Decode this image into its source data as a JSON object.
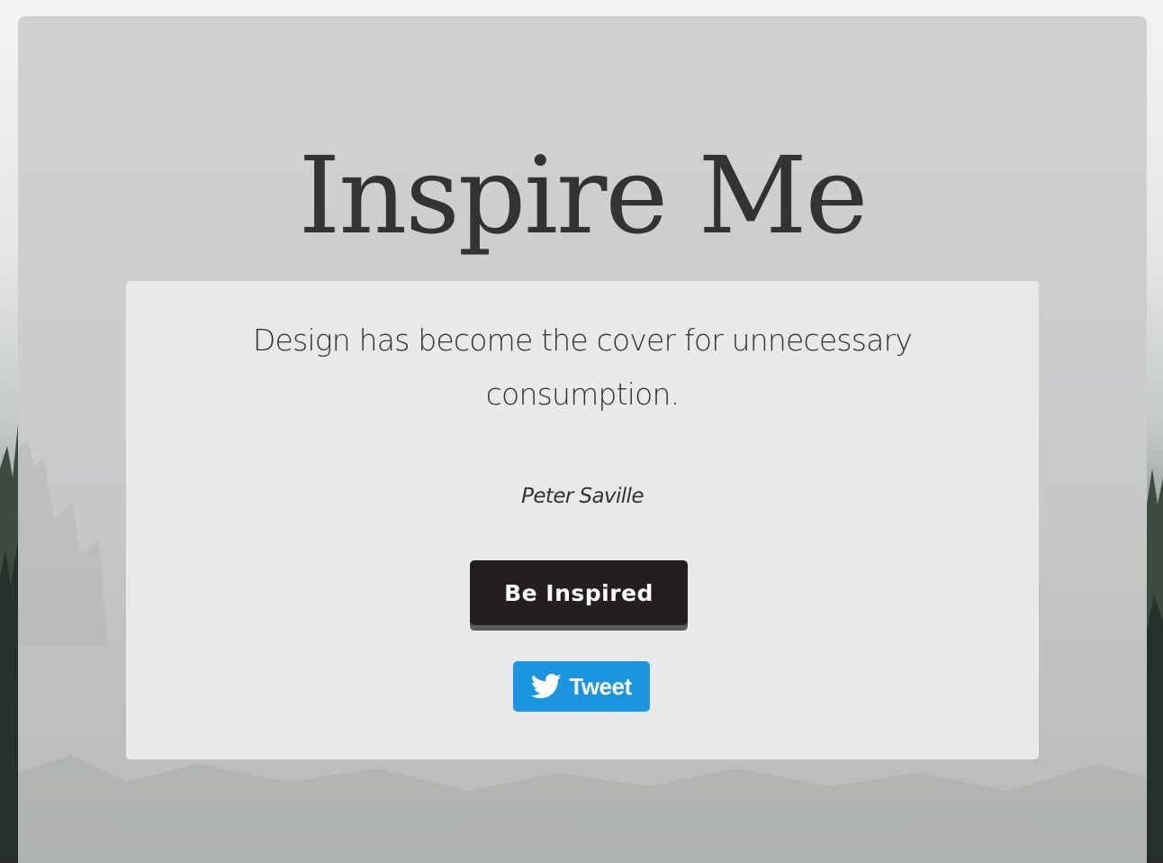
{
  "page": {
    "title": "Inspire Me"
  },
  "quote": {
    "text": "Design has become the cover for unnecessary consumption.",
    "author": "Peter Saville"
  },
  "buttons": {
    "inspire_label": "Be Inspired",
    "tweet_label": "Tweet"
  },
  "icons": {
    "tweet": "twitter-bird-icon"
  },
  "colors": {
    "inspire_button": "#231f20",
    "tweet_button": "#1b95e0",
    "text": "#333333"
  }
}
